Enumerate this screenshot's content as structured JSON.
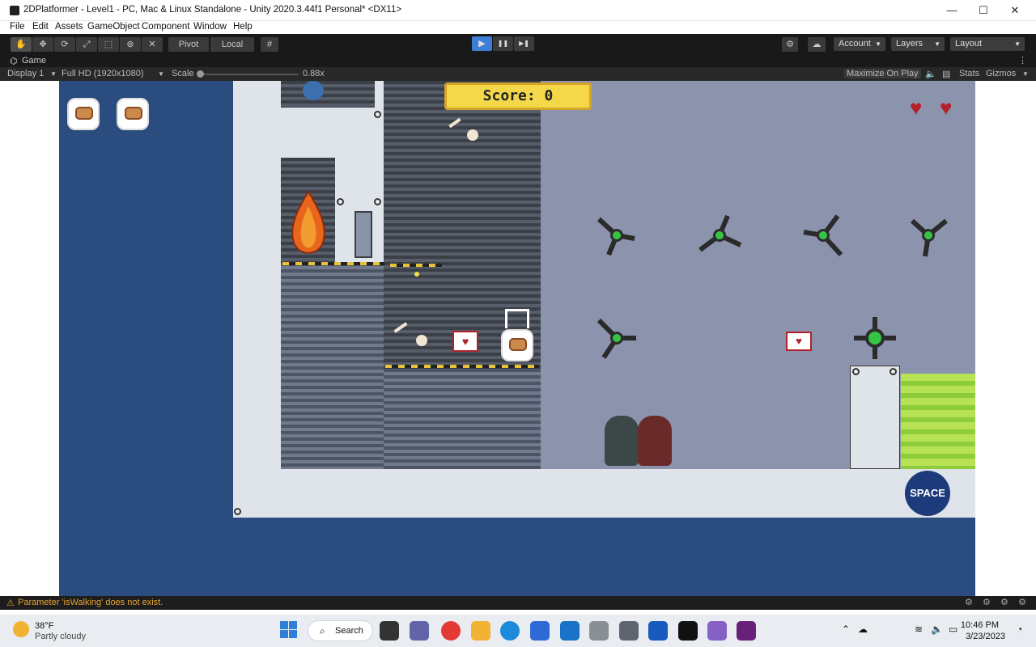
{
  "window": {
    "title": "2DPlatformer - Level1 - PC, Mac & Linux Standalone - Unity 2020.3.44f1 Personal* <DX11>",
    "minimize": "—",
    "maximize": "☐",
    "close": "✕"
  },
  "menu": [
    "File",
    "Edit",
    "Assets",
    "GameObject",
    "Component",
    "Window",
    "Help"
  ],
  "toolbar": {
    "pivot": "Pivot",
    "local": "Local",
    "account": "Account",
    "layers": "Layers",
    "layout": "Layout",
    "play": "▶",
    "pause": "❚❚",
    "step": "▶❚"
  },
  "game_tab": {
    "label": "Game",
    "display": "Display 1",
    "resolution": "Full HD (1920x1080)",
    "scale_label": "Scale",
    "scale_value": "0.88x",
    "maximize": "Maximize On Play",
    "stats": "Stats",
    "gizmos": "Gizmos"
  },
  "hud": {
    "score": "Score: 0",
    "lives": 2,
    "hearts": 2
  },
  "badge": "SPACE",
  "status": {
    "message": "Parameter 'isWalking' does not exist."
  },
  "taskbar": {
    "weather_temp": "38°F",
    "weather_desc": "Partly cloudy",
    "search": "Search",
    "time": "10:46 PM",
    "date": "3/23/2023"
  },
  "colors": {
    "accent": "#3d7fd6",
    "game_bg": "#2b4c7e",
    "status_warn": "#e4a433"
  }
}
